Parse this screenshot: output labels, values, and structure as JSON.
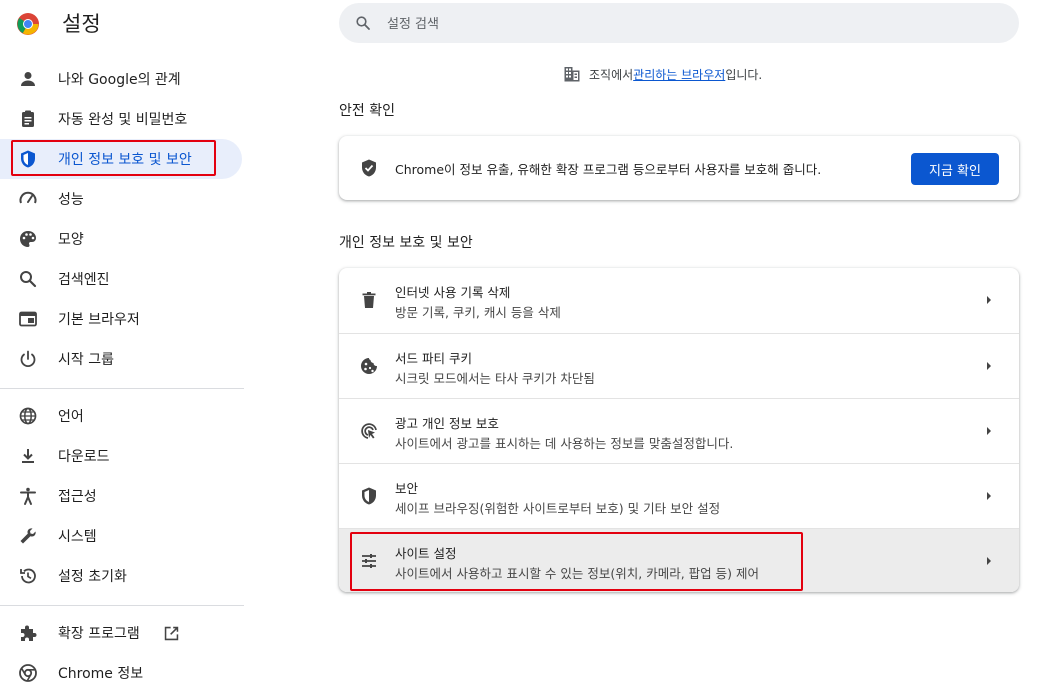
{
  "app": {
    "title": "설정"
  },
  "search": {
    "placeholder": "설정 검색",
    "value": ""
  },
  "managed": {
    "prefix": "조직에서 ",
    "link": "관리하는 브라우저",
    "suffix": "입니다."
  },
  "sidebar": {
    "items": [
      {
        "label": "나와 Google의 관계",
        "icon": "person-icon"
      },
      {
        "label": "자동 완성 및 비밀번호",
        "icon": "clipboard-icon"
      },
      {
        "label": "개인 정보 보호 및 보안",
        "icon": "shield-icon",
        "active": true
      },
      {
        "label": "성능",
        "icon": "speedometer-icon"
      },
      {
        "label": "모양",
        "icon": "palette-icon"
      },
      {
        "label": "검색엔진",
        "icon": "search-icon"
      },
      {
        "label": "기본 브라우저",
        "icon": "browser-icon"
      },
      {
        "label": "시작 그룹",
        "icon": "power-icon"
      },
      {
        "label": "언어",
        "icon": "globe-icon"
      },
      {
        "label": "다운로드",
        "icon": "download-icon"
      },
      {
        "label": "접근성",
        "icon": "accessibility-icon"
      },
      {
        "label": "시스템",
        "icon": "wrench-icon"
      },
      {
        "label": "설정 초기화",
        "icon": "history-icon"
      },
      {
        "label": "확장 프로그램",
        "icon": "puzzle-icon"
      },
      {
        "label": "Chrome 정보",
        "icon": "chrome-icon"
      }
    ]
  },
  "safety": {
    "title": "안전 확인",
    "text": "Chrome이 정보 유출, 유해한 확장 프로그램 등으로부터 사용자를 보호해 줍니다.",
    "button": "지금 확인"
  },
  "privacy": {
    "title": "개인 정보 보호 및 보안",
    "rows": [
      {
        "title": "인터넷 사용 기록 삭제",
        "subtitle": "방문 기록, 쿠키, 캐시 등을 삭제",
        "icon": "trash-icon"
      },
      {
        "title": "서드 파티 쿠키",
        "subtitle": "시크릿 모드에서는 타사 쿠키가 차단됨",
        "icon": "cookie-icon"
      },
      {
        "title": "광고 개인 정보 보호",
        "subtitle": "사이트에서 광고를 표시하는 데 사용하는 정보를 맞춤설정합니다.",
        "icon": "ad-privacy-icon"
      },
      {
        "title": "보안",
        "subtitle": "세이프 브라우징(위험한 사이트로부터 보호) 및 기타 보안 설정",
        "icon": "security-shield-icon"
      },
      {
        "title": "사이트 설정",
        "subtitle": "사이트에서 사용하고 표시할 수 있는 정보(위치, 카메라, 팝업 등) 제어",
        "icon": "tune-icon"
      }
    ]
  },
  "colors": {
    "accent": "#0b57d0",
    "active_bg": "#e8eefb",
    "highlight": "#e3000f"
  }
}
